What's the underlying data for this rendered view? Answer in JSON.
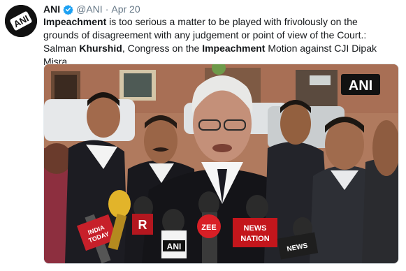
{
  "author": {
    "name": "ANI",
    "handle": "@ANI",
    "separator": "·",
    "date": "Apr 20",
    "avatar_text": "ANI"
  },
  "tweet": {
    "line1_bold": "Impeachment",
    "line1_rest": " is too serious a matter to be played with frivolously on the",
    "line2": "grounds of disagreement with any judgement or point of view of the Court.:",
    "line3_a": "Salman ",
    "line3_bold1": "Khurshid",
    "line3_b": ", Congress on the ",
    "line3_bold2": "Impeachment",
    "line3_c": " Motion against CJI Dipak Misra"
  },
  "media": {
    "watermark": "ANI",
    "mic_labels": {
      "zee": "ZEE",
      "news_nation_1": "NEWS",
      "news_nation_2": "NATION",
      "india_today_1": "INDIA",
      "india_today_2": "TODAY",
      "ani_mic": "ANI",
      "republic": "R",
      "news18": "NEWS"
    }
  },
  "colors": {
    "verified": "#1da1f2",
    "text": "#14171a",
    "secondary": "#657786",
    "building": "#b8785d",
    "zee_red": "#d81f26",
    "news_nation_red": "#c4161c"
  }
}
